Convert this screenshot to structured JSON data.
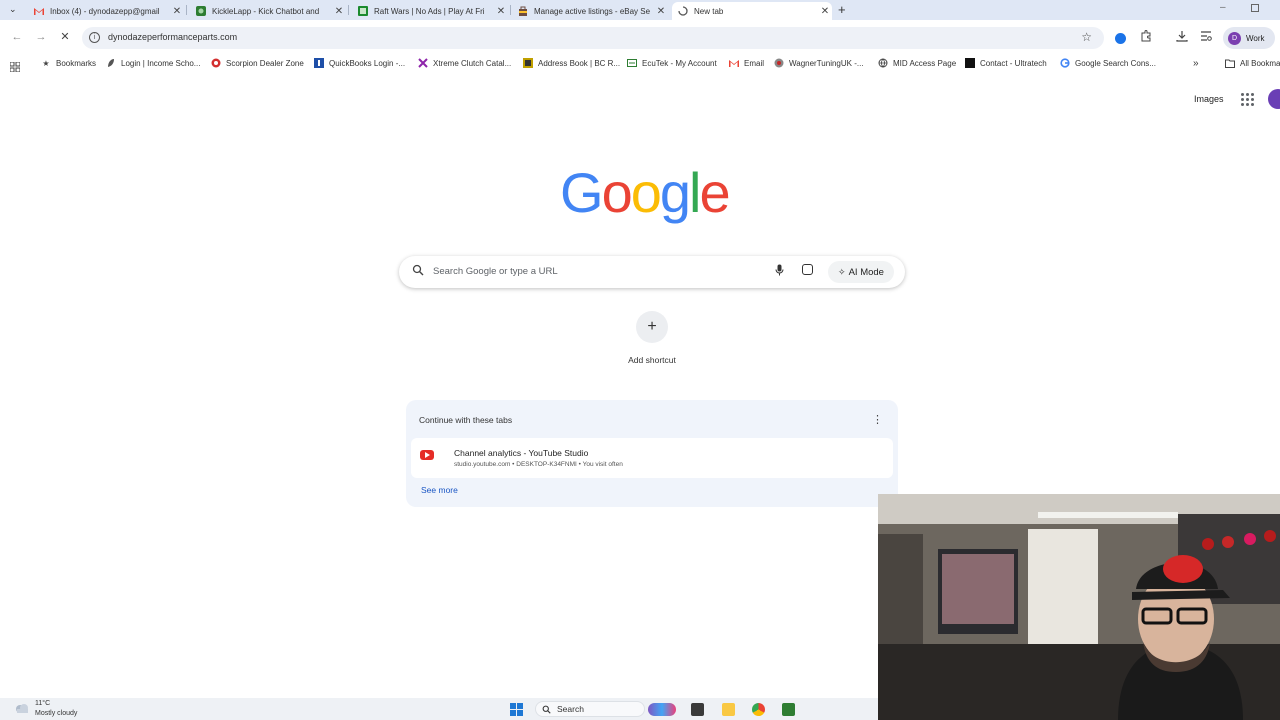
{
  "tabs": [
    {
      "title": "Inbox (4) - dynodazepp@gmail",
      "icon": "gmail-icon"
    },
    {
      "title": "KickleLapp - Kick Chatbot and",
      "icon": "kicklelapp-icon"
    },
    {
      "title": "Raft Wars | No Ads | Play At Fri",
      "icon": "raftwars-icon"
    },
    {
      "title": "Manage active listings - eBay Se",
      "icon": "ebay-icon"
    },
    {
      "title": "New tab",
      "icon": "loading-icon"
    }
  ],
  "toolbar": {
    "url": "dynodazeperformanceparts.com",
    "profile_label": "Work",
    "profile_initial": "D"
  },
  "bookmarks": {
    "items": [
      {
        "label": "Bookmarks",
        "icon": "star-icon"
      },
      {
        "label": "Login | Income Scho...",
        "icon": "income-icon"
      },
      {
        "label": "Scorpion Dealer Zone",
        "icon": "scorpion-icon"
      },
      {
        "label": "QuickBooks Login -...",
        "icon": "quickbooks-icon"
      },
      {
        "label": "Xtreme Clutch Catal...",
        "icon": "xtreme-icon"
      },
      {
        "label": "Address Book | BC R...",
        "icon": "bc-icon"
      },
      {
        "label": "EcuTek - My Account",
        "icon": "ecutek-icon"
      },
      {
        "label": "Email",
        "icon": "gmail-icon"
      },
      {
        "label": "WagnerTuningUK -...",
        "icon": "wagner-icon"
      },
      {
        "label": "MID Access Page",
        "icon": "globe-icon"
      },
      {
        "label": "Contact - Ultratech",
        "icon": "ultratech-icon"
      },
      {
        "label": "Google Search Cons...",
        "icon": "google-icon"
      }
    ],
    "all_label": "All Bookma"
  },
  "ntp": {
    "images_link": "Images",
    "logo": "Google",
    "search_placeholder": "Search Google or type a URL",
    "ai_mode_label": "AI Mode",
    "add_shortcut_label": "Add shortcut",
    "continue_header": "Continue with these tabs",
    "continue_item_title": "Channel analytics - YouTube Studio",
    "continue_item_meta": "studio.youtube.com • DESKTOP-K34FNMI • You visit often",
    "see_more": "See more"
  },
  "taskbar": {
    "temperature": "11°C",
    "condition": "Mostly cloudy",
    "search_label": "Search"
  },
  "colors": {
    "tabstrip_bg": "#dfe7f5",
    "omnibox_bg": "#eef1f7",
    "link_blue": "#1a56c4",
    "google_blue": "#4285f4",
    "google_red": "#ea4335",
    "google_yellow": "#fbbc05",
    "google_green": "#34a853"
  }
}
